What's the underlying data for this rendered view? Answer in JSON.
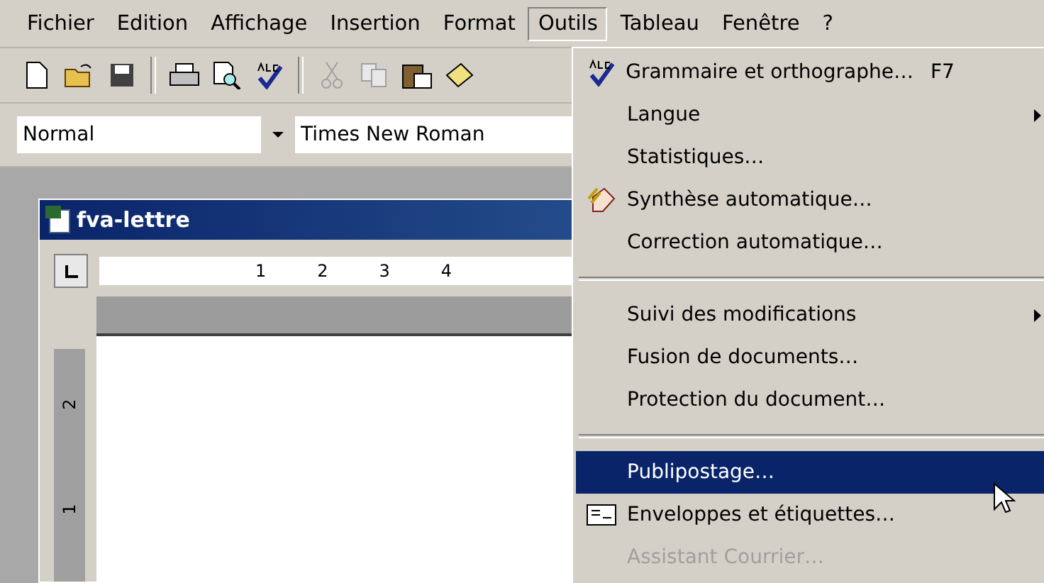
{
  "menu_bar": [
    {
      "label": "Fichier",
      "selected": false
    },
    {
      "label": "Edition",
      "selected": false
    },
    {
      "label": "Affichage",
      "selected": false
    },
    {
      "label": "Insertion",
      "selected": false
    },
    {
      "label": "Format",
      "selected": false
    },
    {
      "label": "Outils",
      "selected": true
    },
    {
      "label": "Tableau",
      "selected": false
    },
    {
      "label": "Fenêtre",
      "selected": false
    },
    {
      "label": "?",
      "selected": false
    }
  ],
  "format_bar": {
    "style": "Normal",
    "font": "Times New Roman"
  },
  "document_window": {
    "title": "fva-lettre",
    "ruler_marks": [
      "1",
      "2",
      "3",
      "4"
    ],
    "vertical_ruler_marks": [
      "2",
      "1"
    ]
  },
  "dropdown_menu": [
    {
      "kind": "item",
      "label": "Grammaire et orthographe…",
      "shortcut": "F7",
      "submenu": false,
      "disabled": false,
      "selected": false
    },
    {
      "kind": "item",
      "label": "Langue",
      "submenu": true,
      "disabled": false,
      "selected": false
    },
    {
      "kind": "item",
      "label": "Statistiques…",
      "submenu": false,
      "disabled": false,
      "selected": false
    },
    {
      "kind": "item",
      "label": "Synthèse automatique…",
      "submenu": false,
      "disabled": false,
      "selected": false
    },
    {
      "kind": "item",
      "label": "Correction automatique…",
      "submenu": false,
      "disabled": false,
      "selected": false
    },
    {
      "kind": "separator"
    },
    {
      "kind": "item",
      "label": "Suivi des modifications",
      "submenu": true,
      "disabled": false,
      "selected": false
    },
    {
      "kind": "item",
      "label": "Fusion de documents…",
      "submenu": false,
      "disabled": false,
      "selected": false
    },
    {
      "kind": "item",
      "label": "Protection du document…",
      "submenu": false,
      "disabled": false,
      "selected": false
    },
    {
      "kind": "separator"
    },
    {
      "kind": "item",
      "label": "Publipostage…",
      "submenu": false,
      "disabled": false,
      "selected": true
    },
    {
      "kind": "item",
      "label": "Enveloppes et étiquettes…",
      "submenu": false,
      "disabled": false,
      "selected": false
    },
    {
      "kind": "item",
      "label": "Assistant Courrier…",
      "submenu": false,
      "disabled": true,
      "selected": false
    }
  ]
}
